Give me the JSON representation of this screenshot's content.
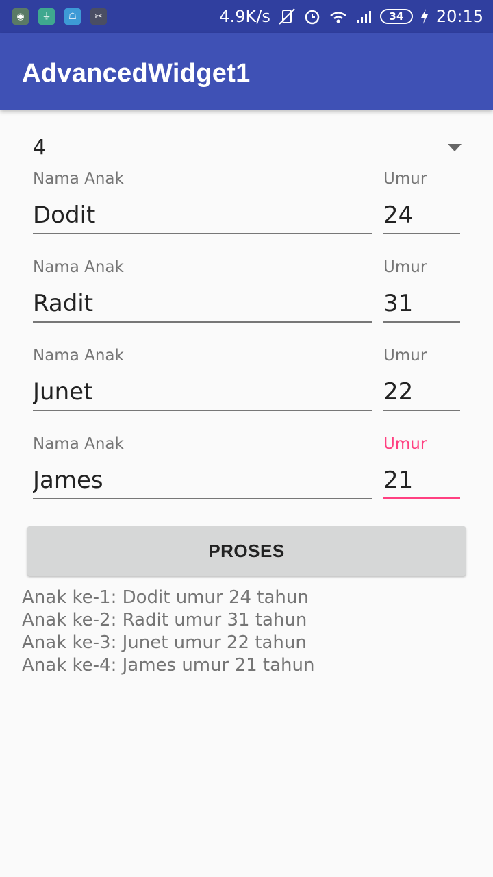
{
  "status_bar": {
    "speed": "4.9K/s",
    "battery": "34",
    "time": "20:15"
  },
  "app_bar": {
    "title": "AdvancedWidget1",
    "color": "#3f51b5",
    "status_color": "#303f9f"
  },
  "spinner": {
    "value": "4"
  },
  "rows": [
    {
      "name_label": "Nama Anak",
      "name_value": "Dodit",
      "age_label": "Umur",
      "age_value": "24"
    },
    {
      "name_label": "Nama Anak",
      "name_value": "Radit",
      "age_label": "Umur",
      "age_value": "31"
    },
    {
      "name_label": "Nama Anak",
      "name_value": "Junet",
      "age_label": "Umur",
      "age_value": "22"
    },
    {
      "name_label": "Nama Anak",
      "name_value": "James",
      "age_label": "Umur",
      "age_value": "21"
    }
  ],
  "accent_color": "#ff4081",
  "button": {
    "label": "PROSES"
  },
  "result": [
    "Anak ke-1: Dodit umur 24 tahun",
    "Anak ke-2: Radit umur 31 tahun",
    "Anak ke-3: Junet umur 22 tahun",
    "Anak ke-4: James umur 21 tahun"
  ]
}
